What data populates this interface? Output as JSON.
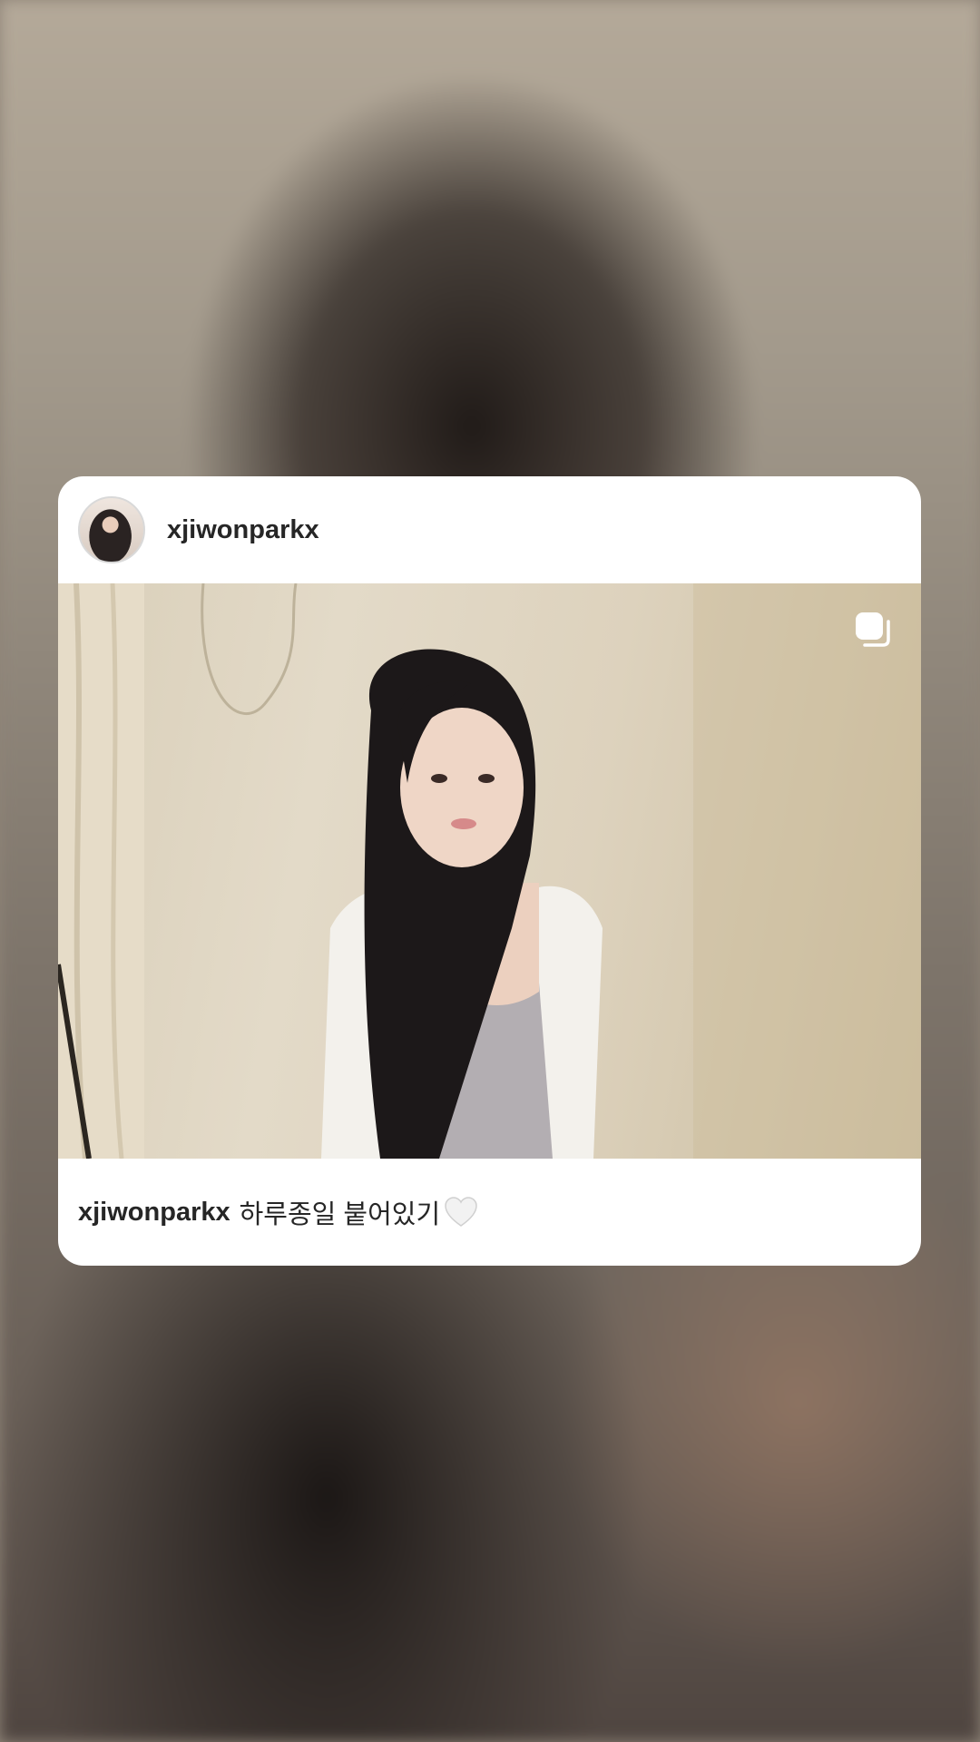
{
  "post": {
    "username": "xjiwonparkx",
    "caption_username": "xjiwonparkx",
    "caption_text": "하루종일 붙어있기",
    "caption_emoji": "white-heart-icon",
    "media_type": "multi-photo-icon"
  },
  "colors": {
    "card_background": "#ffffff",
    "text_primary": "#262626"
  }
}
